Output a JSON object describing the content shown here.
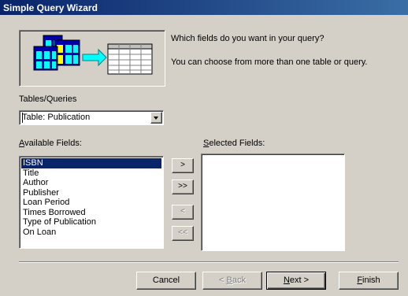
{
  "window": {
    "title": "Simple Query Wizard"
  },
  "intro": {
    "question": "Which fields do you want in your query?",
    "hint": "You can choose from more than one table or query."
  },
  "tables": {
    "label": "Tables/Queries",
    "selected_value": "Table: Publication"
  },
  "available": {
    "label_prefix": "A",
    "label_rest": "vailable Fields:",
    "items": [
      "ISBN",
      "Title",
      "Author",
      "Publisher",
      "Loan Period",
      "Times Borrowed",
      "Type of Publication",
      "On Loan"
    ],
    "selected_index": 0
  },
  "selected": {
    "label_prefix": "S",
    "label_rest": "elected Fields:",
    "items": []
  },
  "move_buttons": {
    "add_one": ">",
    "add_all": ">>",
    "remove_one": "<",
    "remove_all": "<<"
  },
  "footer": {
    "cancel": "Cancel",
    "back_prefix": "< ",
    "back_mnemonic": "B",
    "back_rest": "ack",
    "next_mnemonic": "N",
    "next_rest": "ext >",
    "finish_mnemonic": "F",
    "finish_rest": "inish"
  },
  "colors": {
    "titlebar": "#0a246a",
    "face": "#d4d0c8",
    "selection": "#0a246a",
    "arrow_cyan": "#00ffff"
  }
}
